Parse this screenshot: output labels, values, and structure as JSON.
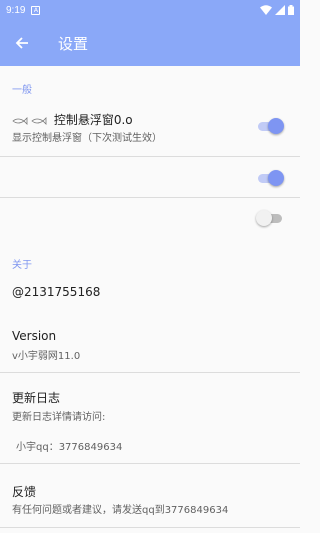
{
  "status_bar": {
    "time": "9:19",
    "notification_icon": "A"
  },
  "toolbar": {
    "title": "设置",
    "back_icon": "arrow-left-icon"
  },
  "sections": {
    "general": {
      "header": "一般",
      "float_window": {
        "title": "控制悬浮窗0.o",
        "summary": "显示控制悬浮窗（下次测试生效）",
        "enabled": true
      },
      "toggle_two": {
        "enabled": true
      },
      "toggle_three": {
        "enabled": false
      }
    },
    "about": {
      "header": "关于",
      "author": "@2131755168",
      "version": {
        "title": "Version",
        "summary": "v小宇弱网11.0"
      },
      "changelog": {
        "title": "更新日志",
        "summary": "更新日志详情请访问:",
        "qq_line": "小宇qq：3776849634"
      },
      "feedback": {
        "title": "反馈",
        "summary": "有任何问题或者建议，请发送qq到3776849634"
      }
    }
  },
  "colors": {
    "toolbar": "#8aa8f8",
    "accent": "#7e95f2",
    "category": "#7f96f0"
  }
}
